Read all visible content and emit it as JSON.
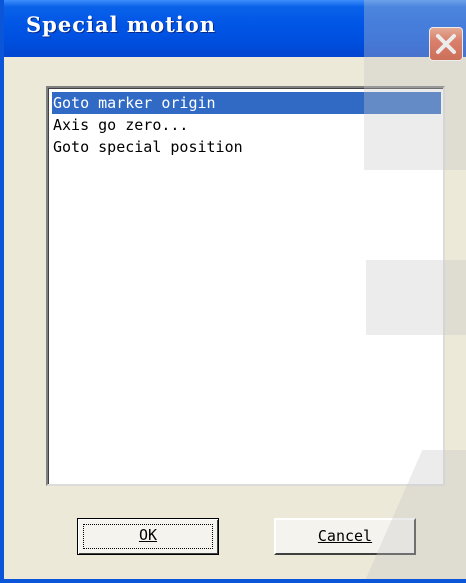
{
  "window": {
    "title": "Special motion",
    "close_icon": "close-icon"
  },
  "list": {
    "items": [
      {
        "label": "Goto marker origin",
        "selected": true
      },
      {
        "label": "Axis go zero...",
        "selected": false
      },
      {
        "label": "Goto special position",
        "selected": false
      }
    ]
  },
  "buttons": {
    "ok_label": "OK",
    "cancel_label": "Cancel"
  },
  "colors": {
    "titlebar": "#0055e5",
    "selection": "#316ac5",
    "close_button": "#e2593a",
    "dialog_face": "#ece9d8"
  }
}
